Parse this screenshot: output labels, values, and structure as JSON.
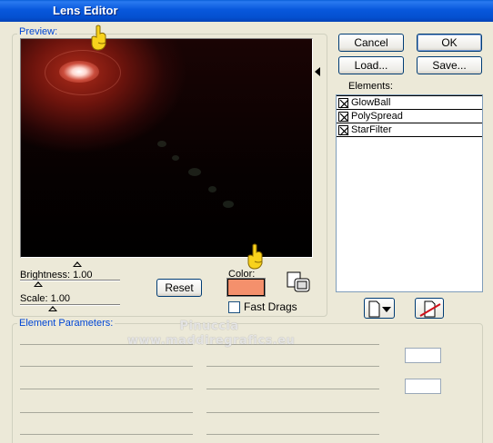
{
  "window": {
    "title": "Lens Editor"
  },
  "preview": {
    "label": "Preview:"
  },
  "sliders": {
    "brightness": {
      "label": "Brightness:",
      "value": "1.00"
    },
    "scale": {
      "label": "Scale:",
      "value": "1.00"
    }
  },
  "buttons": {
    "reset": "Reset",
    "cancel": "Cancel",
    "ok": "OK",
    "load": "Load...",
    "save": "Save..."
  },
  "color": {
    "label": "Color:",
    "value": "#f4906c"
  },
  "fast_drags": {
    "label": "Fast Drags",
    "checked": false
  },
  "elements": {
    "label": "Elements:",
    "items": [
      {
        "label": "GlowBall",
        "checked": true
      },
      {
        "label": "PolySpread",
        "checked": true
      },
      {
        "label": "StarFilter",
        "checked": true
      }
    ]
  },
  "element_parameters": {
    "label": "Element Parameters:"
  },
  "watermark": {
    "line1": "Pinuccia",
    "line2": "www.maddiregrafics.eu"
  },
  "icons": [
    "pointing-hand-icon",
    "copy-color-icon",
    "new-element-icon",
    "delete-element-icon",
    "checkbox-x-icon"
  ]
}
